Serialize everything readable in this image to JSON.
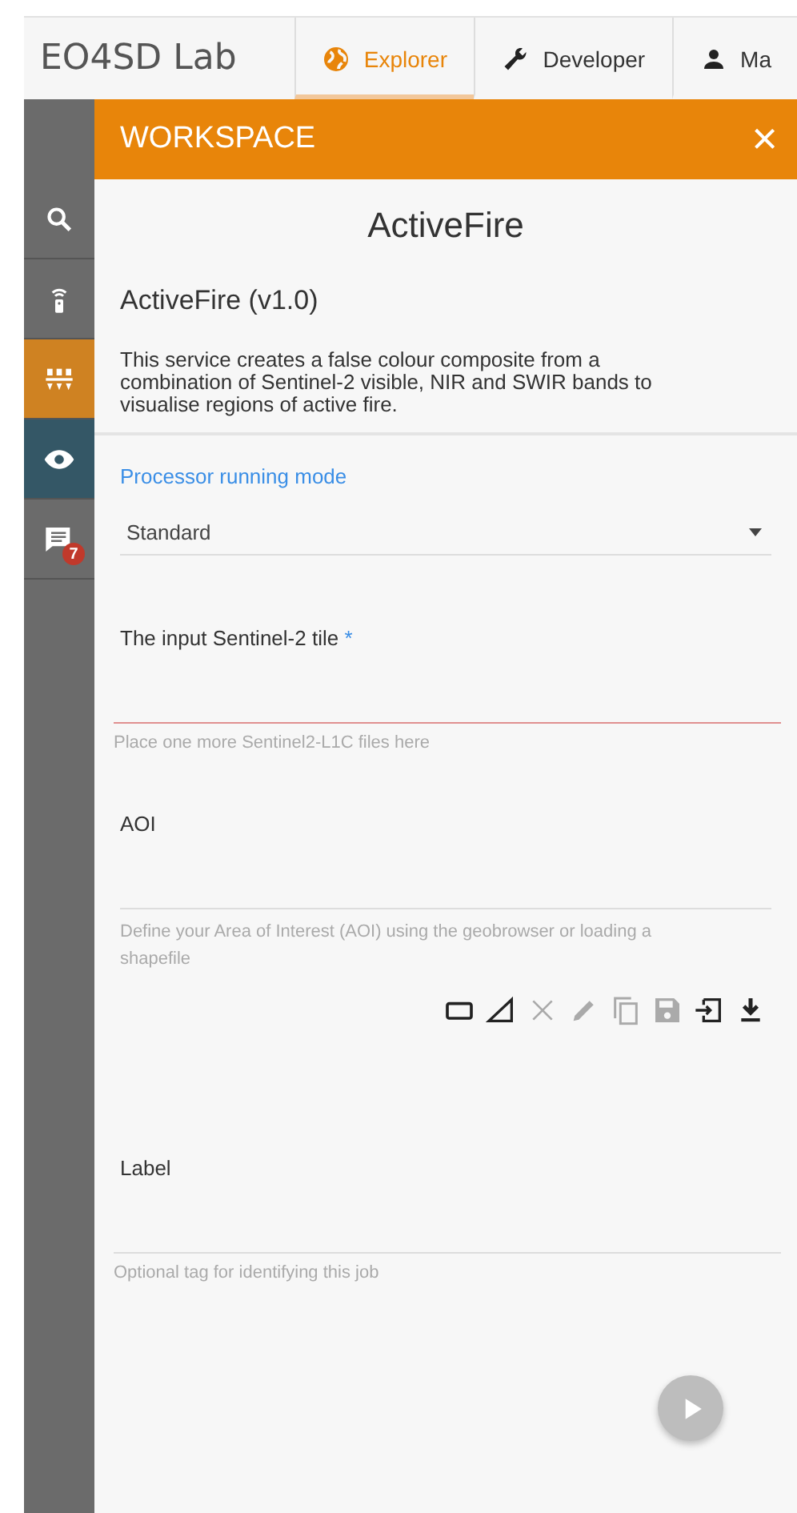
{
  "header": {
    "logo": "EO4SD Lab",
    "tabs": [
      {
        "label": "Explorer",
        "selected": true
      },
      {
        "label": "Developer",
        "selected": false
      },
      {
        "label": "Ma",
        "selected": false
      }
    ]
  },
  "sidebar": {
    "items": [
      {
        "color": "#6b6b6b"
      },
      {
        "color": "#6b6b6b"
      },
      {
        "color": "#cf8222"
      },
      {
        "color": "#345766"
      },
      {
        "color": "#6b6b6b",
        "badge": "7"
      }
    ]
  },
  "panel": {
    "title": "WORKSPACE",
    "close": "×"
  },
  "service": {
    "title": "ActiveFire",
    "name": "ActiveFire (v1.0)",
    "description": "This service creates a false colour composite from a combination of Sentinel-2 visible, NIR and SWIR bands to visualise regions of active fire."
  },
  "fields": [
    {
      "kind": "select",
      "label": "Processor running mode",
      "value": "Standard"
    },
    {
      "kind": "text",
      "label": "The input Sentinel-2 tile",
      "required_mark": "*",
      "invalid": true,
      "hint": "Place one more Sentinel2-L1C files here"
    },
    {
      "kind": "area",
      "label": "AOI",
      "invalid": false,
      "hint": "Define your Area of Interest (AOI) using the geobrowser or loading a shapefile",
      "tools": [
        {
          "disabled": false
        },
        {
          "disabled": false
        },
        {
          "disabled": true
        },
        {
          "disabled": true
        },
        {
          "disabled": true
        },
        {
          "disabled": true
        },
        {
          "disabled": false
        },
        {
          "disabled": false
        }
      ]
    },
    {
      "kind": "text",
      "label": "Label",
      "invalid": false,
      "hint": "Optional tag for identifying this job"
    }
  ],
  "run_button": {
    "disabled": true
  }
}
